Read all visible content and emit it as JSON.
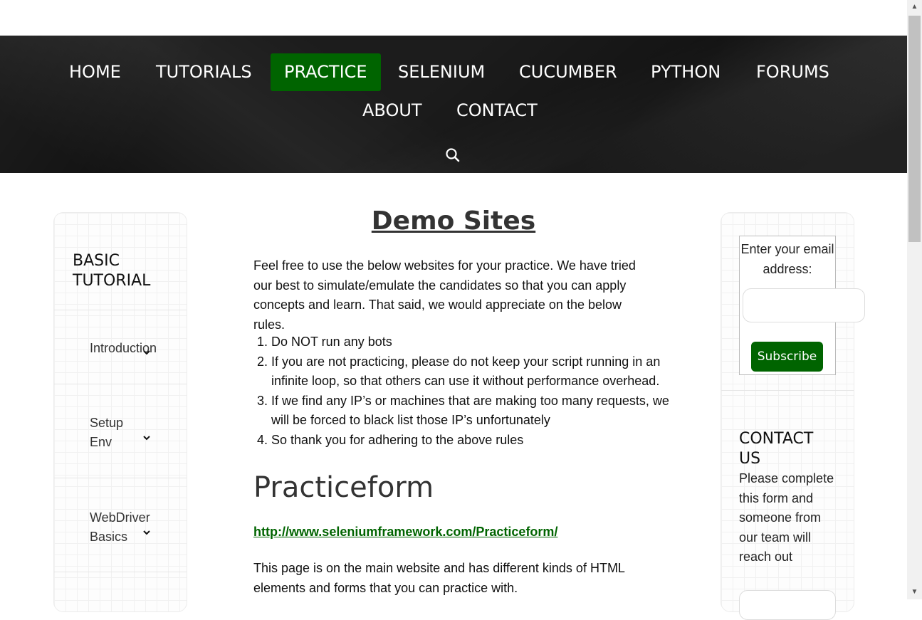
{
  "nav": {
    "items": [
      {
        "label": "HOME",
        "active": false
      },
      {
        "label": "TUTORIALS",
        "active": false
      },
      {
        "label": "PRACTICE",
        "active": true
      },
      {
        "label": "SELENIUM",
        "active": false
      },
      {
        "label": "CUCUMBER",
        "active": false
      },
      {
        "label": "PYTHON",
        "active": false
      },
      {
        "label": "FORUMS",
        "active": false
      },
      {
        "label": "ABOUT",
        "active": false
      },
      {
        "label": "CONTACT",
        "active": false
      }
    ],
    "search_icon": "search-icon",
    "active_color": "#006400"
  },
  "left_sidebar": {
    "title": "BASIC TUTORIAL",
    "items": [
      {
        "label": "Introduction"
      },
      {
        "label": "Setup Env"
      },
      {
        "label": "WebDriver Basics"
      }
    ]
  },
  "main": {
    "title": "Demo Sites",
    "intro": "Feel free to use the below websites for your practice. We have tried our best to simulate/emulate the candidates so that you can apply concepts and learn. That said, we would appreciate on the below rules.",
    "rules": [
      "Do NOT run any bots",
      "If you are not practicing, please do not keep your script running in an infinite loop, so that others can use it without performance overhead.",
      "If we find any IP’s or machines that are making too many requests, we will be forced to black list those IP’s unfortunately",
      "So thank you for adhering to the above rules"
    ],
    "section_heading": "Practiceform",
    "link": "http://www.seleniumframework.com/Practiceform/",
    "description": "This page is on the main website and has different kinds of HTML elements and forms that you can practice with."
  },
  "right_sidebar": {
    "subscribe_label": "Enter your email address:",
    "email_value": "",
    "subscribe_button": "Subscribe",
    "contact_title": "CONTACT US",
    "contact_text": "Please complete this form and someone from our team will reach out"
  }
}
